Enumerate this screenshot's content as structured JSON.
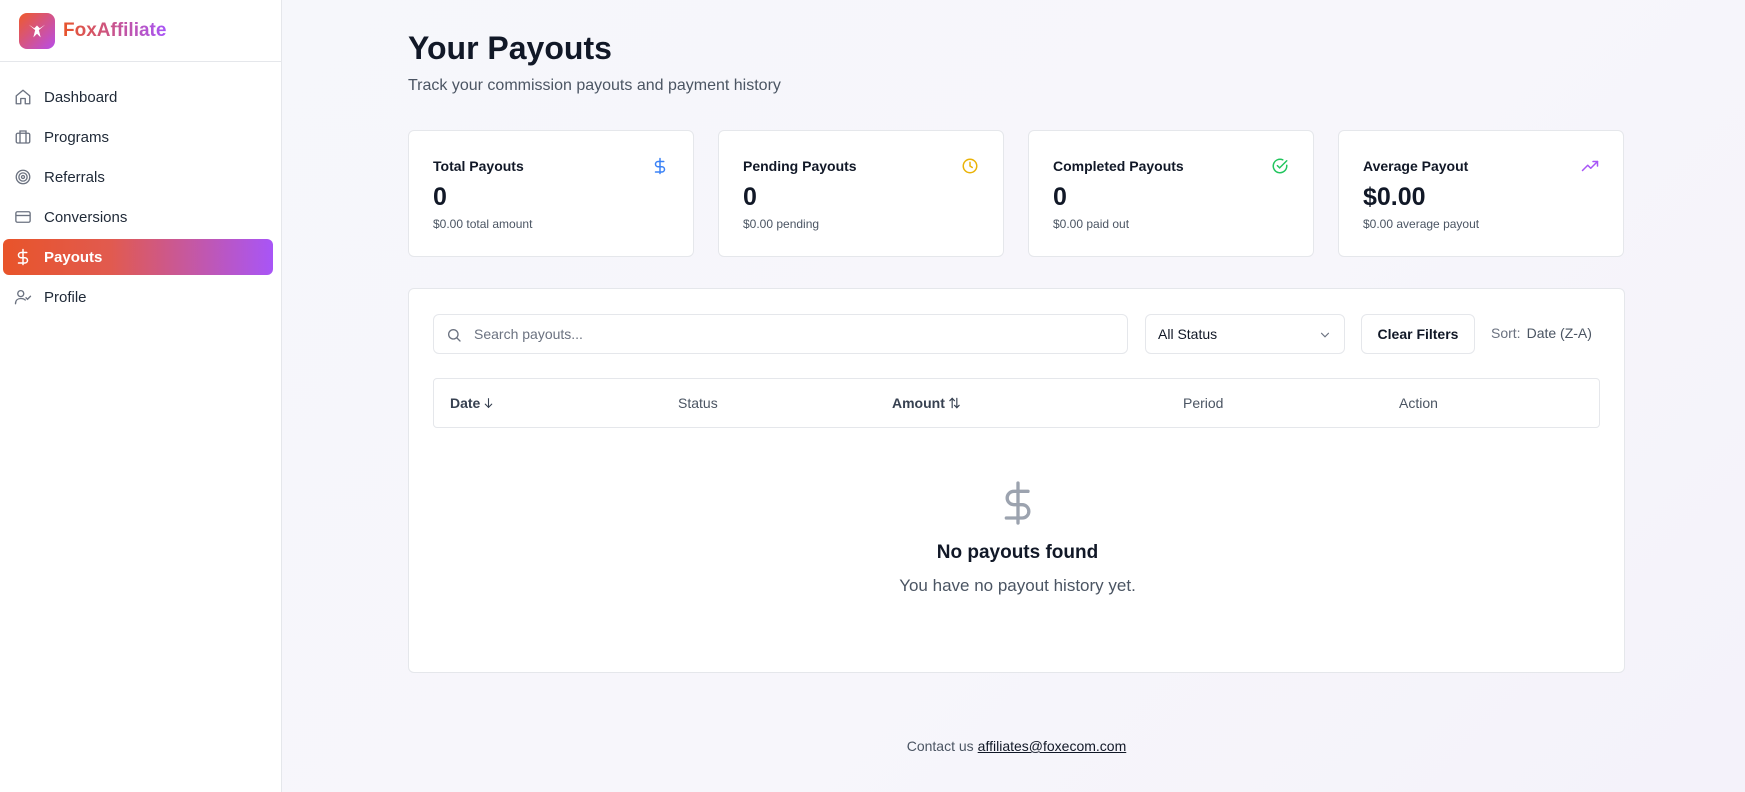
{
  "brand": {
    "name": "FoxAffiliate",
    "logo_icon": "fox-logo-icon"
  },
  "sidebar": {
    "items": [
      {
        "label": "Dashboard",
        "icon": "home-icon"
      },
      {
        "label": "Programs",
        "icon": "briefcase-icon"
      },
      {
        "label": "Referrals",
        "icon": "target-icon"
      },
      {
        "label": "Conversions",
        "icon": "credit-card-icon"
      },
      {
        "label": "Payouts",
        "icon": "dollar-icon",
        "active": true
      },
      {
        "label": "Profile",
        "icon": "user-check-icon"
      }
    ]
  },
  "header": {
    "title": "Your Payouts",
    "subtitle": "Track your commission payouts and payment history"
  },
  "stats": [
    {
      "title": "Total Payouts",
      "value": "0",
      "note": "$0.00 total amount",
      "icon": "dollar-icon",
      "color": "#3b82f6"
    },
    {
      "title": "Pending Payouts",
      "value": "0",
      "note": "$0.00 pending",
      "icon": "clock-icon",
      "color": "#eab308"
    },
    {
      "title": "Completed Payouts",
      "value": "0",
      "note": "$0.00 paid out",
      "icon": "check-circle-icon",
      "color": "#22c55e"
    },
    {
      "title": "Average Payout",
      "value": "$0.00",
      "note": "$0.00 average payout",
      "icon": "trending-up-icon",
      "color": "#a855f7"
    }
  ],
  "filters": {
    "search_placeholder": "Search payouts...",
    "status_selected": "All Status",
    "clear_label": "Clear Filters",
    "sort_label": "Sort:",
    "sort_value": "Date (Z-A)"
  },
  "table": {
    "columns": [
      "Date",
      "Status",
      "Amount",
      "Period",
      "Action"
    ]
  },
  "empty": {
    "title": "No payouts found",
    "subtitle": "You have no payout history yet."
  },
  "footer": {
    "contact_text": "Contact us",
    "email": "affiliates@foxecom.com"
  },
  "colors": {
    "accent_start": "#e8542a",
    "accent_end": "#a855f7"
  }
}
